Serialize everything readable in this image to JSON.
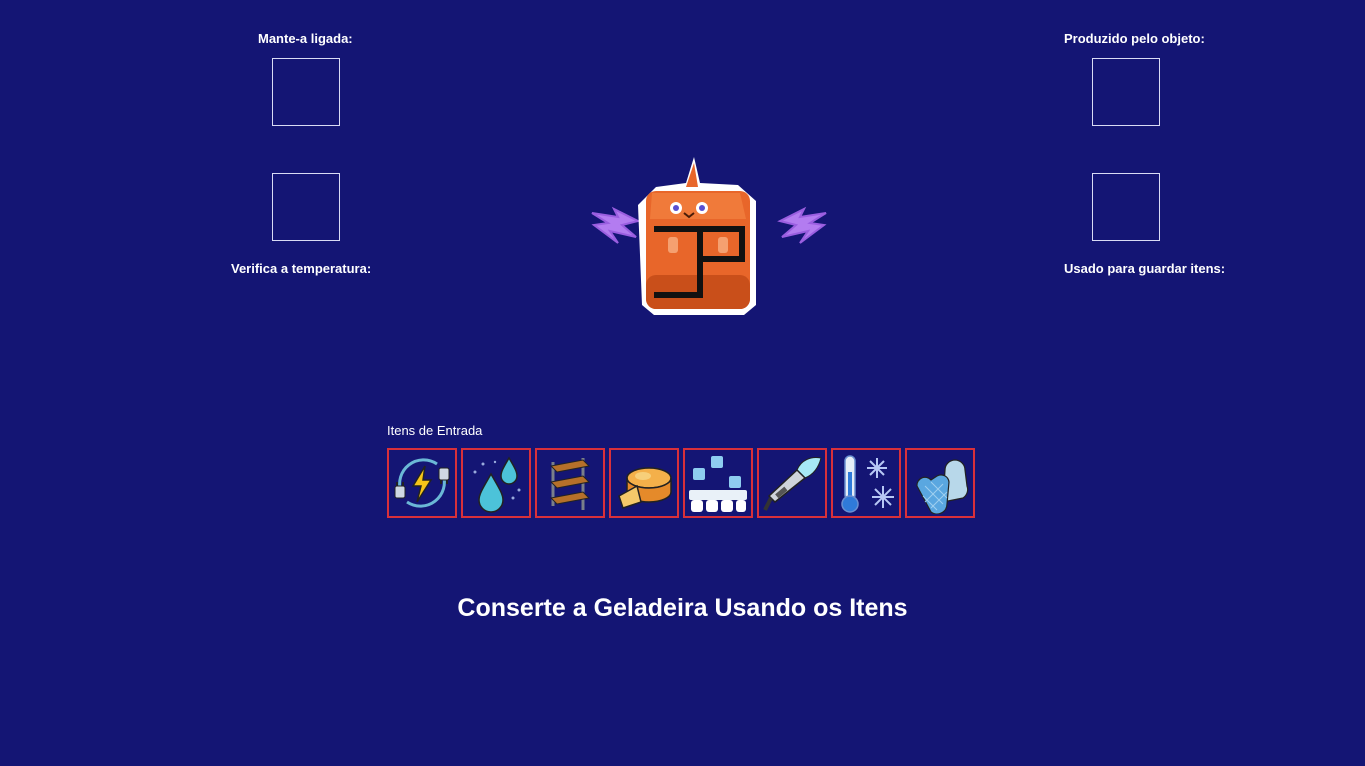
{
  "slots": {
    "top_left_label": "Mante-a ligada:",
    "bottom_left_label": "Verifica a temperatura:",
    "top_right_label": "Produzido pelo objeto:",
    "bottom_right_label": "Usado para guardar itens:"
  },
  "inventory": {
    "title": "Itens de Entrada",
    "items": [
      {
        "icon": "power-plug-icon"
      },
      {
        "icon": "water-drops-icon"
      },
      {
        "icon": "shelves-icon"
      },
      {
        "icon": "cheese-icon"
      },
      {
        "icon": "ice-cube-tray-icon"
      },
      {
        "icon": "water-hose-icon"
      },
      {
        "icon": "thermometer-snowflake-icon"
      },
      {
        "icon": "oven-mitt-icon"
      }
    ]
  },
  "instruction": "Conserte a Geladeira Usando os Itens",
  "colors": {
    "background": "#141574",
    "item_border": "#d9303a",
    "slot_border": "#d9dbf5",
    "text": "#ffffff"
  }
}
